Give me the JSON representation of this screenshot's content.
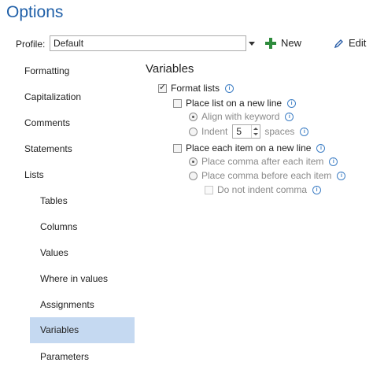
{
  "title": "Options",
  "profile": {
    "label": "Profile:",
    "value": "Default"
  },
  "toolbar": {
    "new_label": "New",
    "edit_label": "Edit"
  },
  "nav": {
    "items": [
      {
        "label": "Formatting"
      },
      {
        "label": "Capitalization"
      },
      {
        "label": "Comments"
      },
      {
        "label": "Statements"
      },
      {
        "label": "Lists"
      },
      {
        "label": "Tables"
      },
      {
        "label": "Columns"
      },
      {
        "label": "Values"
      },
      {
        "label": "Where in values"
      },
      {
        "label": "Assignments"
      },
      {
        "label": "Variables",
        "selected": true
      },
      {
        "label": "Parameters"
      }
    ]
  },
  "section": {
    "title": "Variables",
    "format_lists": {
      "label": "Format lists",
      "checked": true
    },
    "place_list_new_line": {
      "label": "Place list on a new line",
      "checked": false
    },
    "align_keyword": {
      "label": "Align with keyword",
      "checked": true
    },
    "indent": {
      "label": "Indent",
      "value": "5",
      "unit": "spaces",
      "checked": false
    },
    "place_each_item": {
      "label": "Place each item on a new line",
      "checked": false
    },
    "comma_after": {
      "label": "Place comma after each item",
      "checked": true
    },
    "comma_before": {
      "label": "Place comma before each item",
      "checked": false
    },
    "no_indent_comma": {
      "label": "Do not indent comma",
      "checked": false
    }
  },
  "colors": {
    "accent": "#1f5fa8",
    "selection": "#c5d9f1",
    "plus": "#2e8b3c"
  }
}
